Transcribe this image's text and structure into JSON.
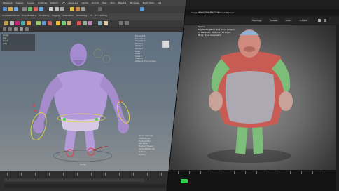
{
  "left_app": {
    "menu": [
      "Modeling",
      "Display",
      "Curves",
      "Surfaces",
      "Deform",
      "UV",
      "Generate",
      "Cache",
      "Arnold",
      "Help",
      "Skin",
      "Rigging",
      "Windows",
      "Mesh Tools",
      "Key",
      "Rigging",
      "Constrain",
      "Control",
      "Skeleton",
      "Help"
    ],
    "shelf_tabs": [
      "Curves/Surfaces",
      "Poly Modeling",
      "Sculpting",
      "Rigging",
      "Animation",
      "Rendering",
      "FX",
      "FX Caching",
      "Custom",
      "Arnold",
      "Bifrost",
      "MASH",
      "Motion Graphics",
      "XGen"
    ],
    "outliner_items": [
      "persp",
      "top",
      "front",
      "side"
    ],
    "channel_box": [
      "Translate X",
      "Translate Y",
      "Translate Z",
      "Rotate X",
      "Rotate Y",
      "Rotate Z",
      "Scale X",
      "Scale Y",
      "Scale Z",
      "Visibility",
      "Distance From Camera",
      "Selected Shapes"
    ],
    "attributes": [
      "Shear Channels",
      "Focal Length",
      "Tumble/Dolly",
      "Spd Speed",
      "Playback Speed",
      "Current Character",
      "IK Blend",
      "Tumble"
    ],
    "viewport_label": "persp"
  },
  "right_app": {
    "top_title": "Real-Time Renderer",
    "toolbar": [
      "Image Tracker Source",
      "Refresh Preview"
    ],
    "view_controls": [
      "Topology",
      "Shader",
      "Auto",
      "1:1000"
    ],
    "info": [
      "Status",
      "Big Mister Jaimo and Mond (Polym)",
      "In Samples: 36 Block: 36 Block",
      "Body Type: Polymetric"
    ]
  },
  "colors": {
    "accent_green": "#32d04d",
    "char_purple": "#b39ad8",
    "char_green": "#7dbd7a",
    "char_red": "#c85c55"
  }
}
